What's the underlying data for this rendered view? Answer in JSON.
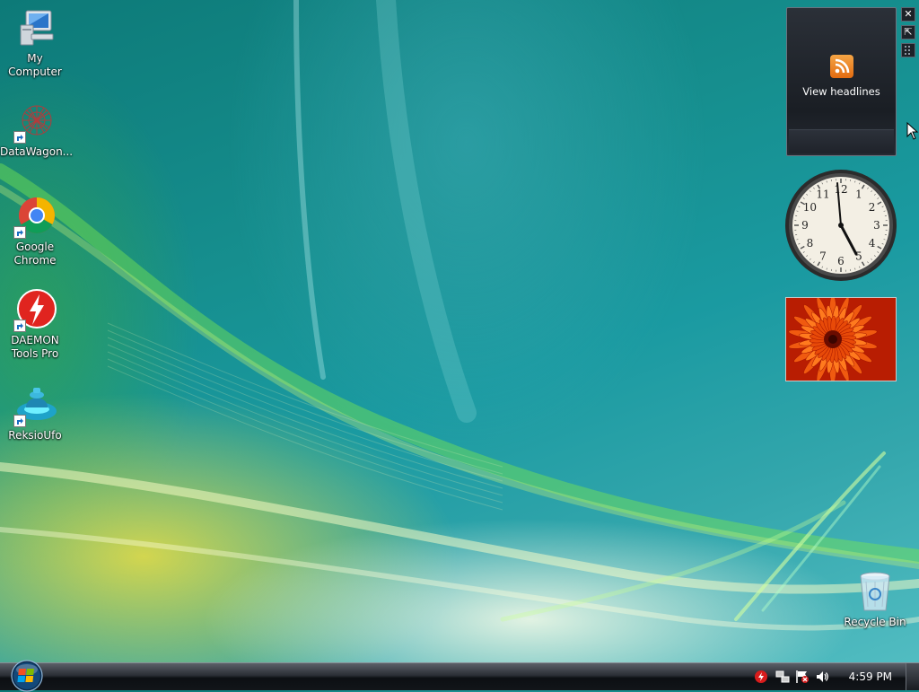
{
  "desktop": {
    "icons": [
      {
        "label": "My Computer",
        "icon": "my-computer-icon"
      },
      {
        "label": "DataWagon...",
        "icon": "datawagon-icon"
      },
      {
        "label": "Google Chrome",
        "icon": "chrome-icon"
      },
      {
        "label": "DAEMON Tools Pro",
        "icon": "daemon-tools-icon"
      },
      {
        "label": "ReksioUfo",
        "icon": "reksioufo-icon"
      },
      {
        "label": "Recycle Bin",
        "icon": "recycle-bin-icon"
      }
    ]
  },
  "sidebar": {
    "feed_gadget": {
      "label": "View headlines",
      "icon": "rss-icon"
    },
    "controls": {
      "close": "✕",
      "options": "⇱"
    },
    "clock_gadget": {
      "hour_numerals": [
        "12",
        "1",
        "2",
        "3",
        "4",
        "5",
        "6",
        "7",
        "8",
        "9",
        "10",
        "11"
      ]
    },
    "slideshow_gadget": {
      "image": "orange-flower-photo"
    }
  },
  "taskbar": {
    "start": {
      "icon": "windows-logo-icon"
    },
    "tray": {
      "icons": [
        "antivirus-icon",
        "network-icon",
        "action-center-flag-icon",
        "volume-icon"
      ],
      "time": "4:59 PM"
    }
  }
}
